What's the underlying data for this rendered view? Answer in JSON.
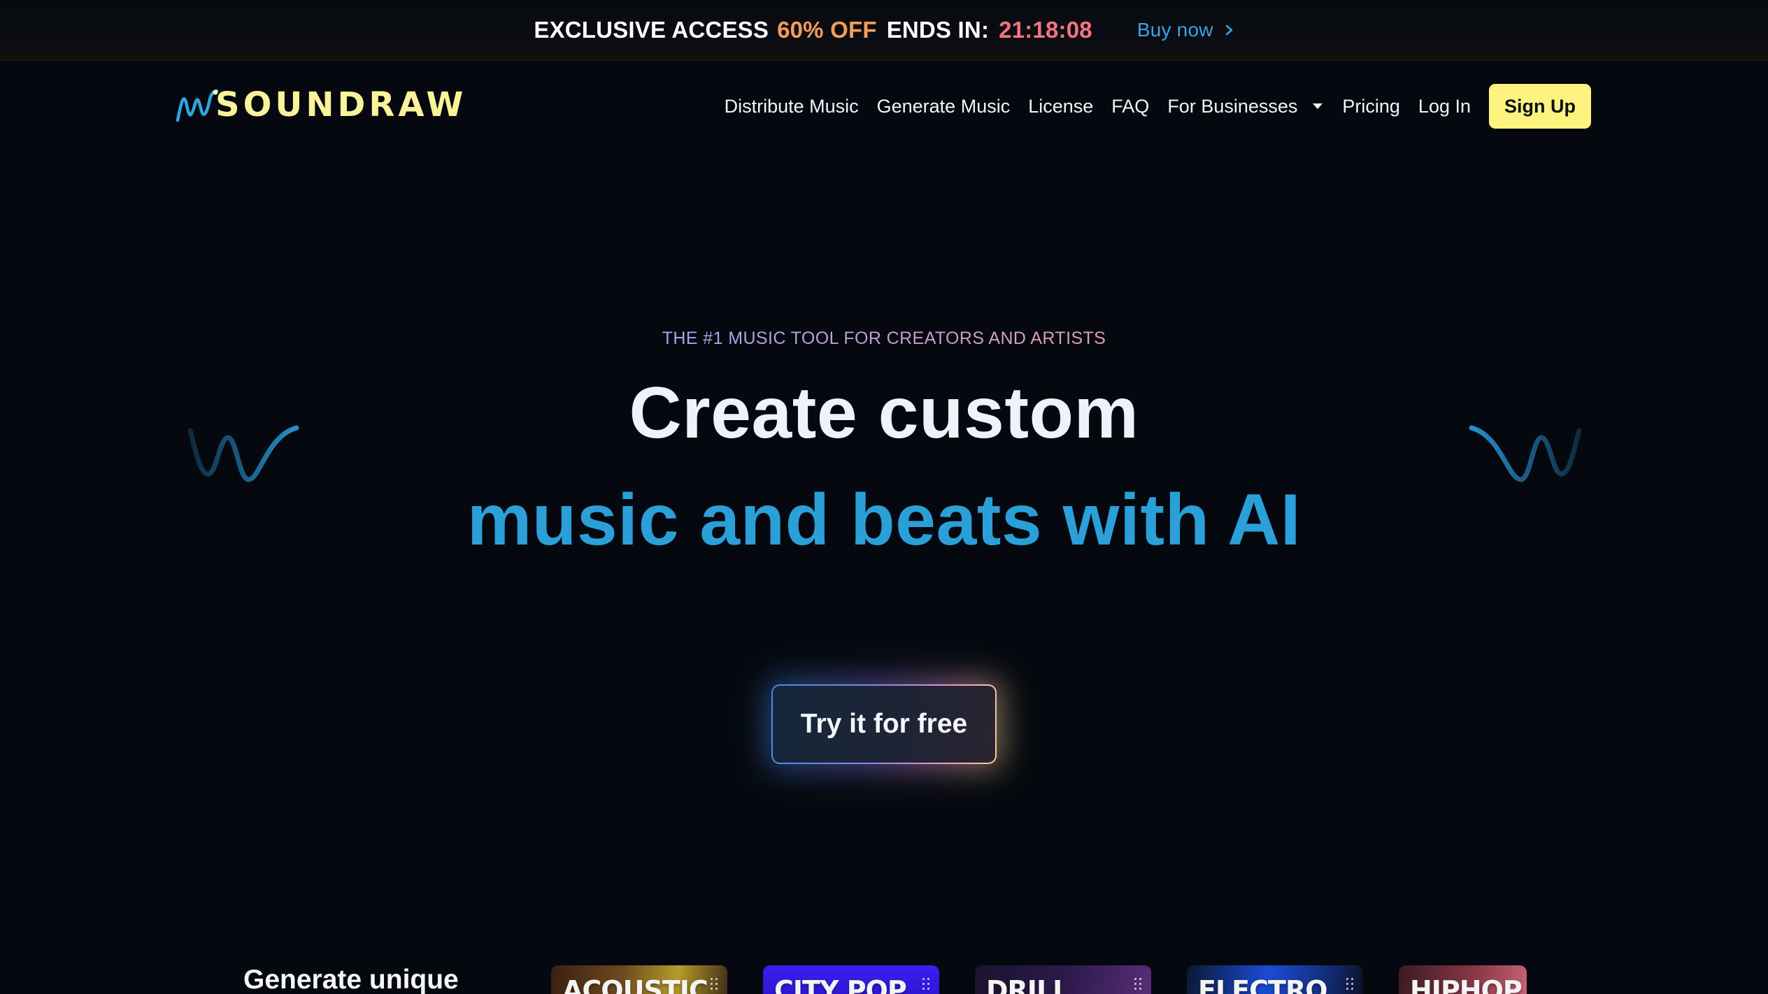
{
  "promo": {
    "label": "EXCLUSIVE ACCESS",
    "discount": "60% OFF",
    "ends_label": "ENDS IN:",
    "timer": "21:18:08",
    "buy_label": "Buy now"
  },
  "nav": {
    "logo_text": "SOUNDRAW",
    "items": [
      "Distribute Music",
      "Generate Music",
      "License",
      "FAQ",
      "For Businesses",
      "Pricing",
      "Log In"
    ],
    "signup_label": "Sign Up"
  },
  "hero": {
    "eyebrow": "THE #1 MUSIC TOOL FOR CREATORS AND ARTISTS",
    "title_line1": "Create custom",
    "title_line2": "music and beats with AI",
    "cta_label": "Try it for free"
  },
  "genres": {
    "title": "Generate unique",
    "items": [
      "ACOUSTIC",
      "CITY POP",
      "DRILL",
      "ELECTRO",
      "HIPHOP"
    ]
  },
  "colors": {
    "background": "#05090f",
    "accent_blue": "#2a9fd8",
    "logo_yellow": "#fbf39a",
    "signup_yellow": "#fdf37e",
    "discount_orange": "#f39c5b",
    "timer_red": "#f2747f"
  },
  "icons": {
    "buy_chevron": "chevron-right-icon",
    "businesses_dropdown": "caret-down-icon",
    "logo_mark": "waveform-icon",
    "decorative_wave": "wave-icon"
  }
}
